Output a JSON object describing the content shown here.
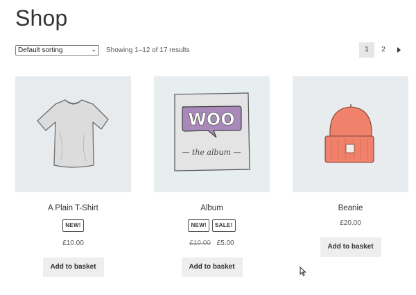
{
  "page": {
    "title": "Shop"
  },
  "toolbar": {
    "sorting_selected": "Default sorting",
    "result_count": "Showing 1–12 of 17 results"
  },
  "pagination": {
    "pages": [
      "1",
      "2"
    ],
    "current": "1",
    "next_icon": "arrow-right-icon"
  },
  "products": [
    {
      "title": "A Plain T-Shirt",
      "badges": [
        "NEW!"
      ],
      "price_old": "",
      "price": "£10.00",
      "button": "Add to basket",
      "image": "tshirt-image",
      "thumb_bg": "#e8ebee"
    },
    {
      "title": "Album",
      "badges": [
        "NEW!",
        "SALE!"
      ],
      "price_old": "£10.00",
      "price": "£5.00",
      "button": "Add to basket",
      "image": "woo-album-image",
      "thumb_bg": "#e6eef0"
    },
    {
      "title": "Beanie",
      "badges": [],
      "price_old": "",
      "price": "£20.00",
      "button": "Add to basket",
      "image": "beanie-image",
      "thumb_bg": "#e9ecef"
    }
  ],
  "colors": {
    "button_bg": "#eeeeee",
    "pager_current_bg": "#e6e6e6",
    "beanie": "#f0816b",
    "woo_purple": "#a889b9"
  }
}
